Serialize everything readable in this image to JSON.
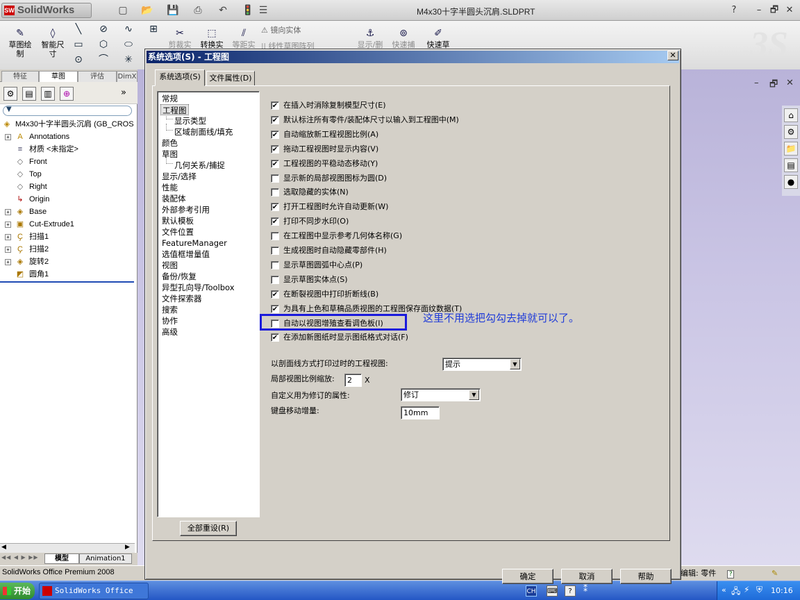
{
  "app": {
    "logo": "SolidWorks",
    "doc_title": "M4x30十字半圆头沉肩.SLDPRT",
    "window_controls": [
      "?",
      "–",
      "🗗",
      "✕"
    ]
  },
  "toolbar": {
    "tools": [
      {
        "label": "草图绘\n制",
        "icon": "sketch-icon"
      },
      {
        "label": "智能尺\n寸",
        "icon": "dimension-icon"
      },
      {
        "label": "剪裁实",
        "icon": "trim-icon"
      },
      {
        "label": "转换实",
        "icon": "convert-icon"
      },
      {
        "label": "等距实",
        "icon": "offset-icon"
      },
      {
        "label": "显示/删",
        "icon": "display-delete-icon"
      },
      {
        "label": "快速捕",
        "icon": "quick-snap-icon"
      },
      {
        "label": "快速草",
        "icon": "rapid-sketch-icon"
      }
    ],
    "mirror_label": "镜向实体",
    "pattern_label": "线性草图阵列"
  },
  "left_pane": {
    "tabs": [
      "特征",
      "草图",
      "评估",
      "DimX"
    ],
    "active_tab": "草图",
    "root_label": "M4x30十字半圆头沉肩 (GB_CROS",
    "tree": [
      {
        "label": "Annotations",
        "icon": "A",
        "expand": true
      },
      {
        "label": "材质 <未指定>",
        "icon": "≡",
        "expand": false
      },
      {
        "label": "Front",
        "icon": "◇",
        "expand": false
      },
      {
        "label": "Top",
        "icon": "◇",
        "expand": false
      },
      {
        "label": "Right",
        "icon": "◇",
        "expand": false
      },
      {
        "label": "Origin",
        "icon": "↳",
        "expand": false
      },
      {
        "label": "Base",
        "icon": "◈",
        "expand": true
      },
      {
        "label": "Cut-Extrude1",
        "icon": "▣",
        "expand": true
      },
      {
        "label": "扫描1",
        "icon": "Ҫ",
        "expand": true
      },
      {
        "label": "扫描2",
        "icon": "Ҫ",
        "expand": true
      },
      {
        "label": "旋转2",
        "icon": "◈",
        "expand": true
      },
      {
        "label": "圆角1",
        "icon": "◩",
        "expand": false
      }
    ],
    "bottom_tabs": [
      "模型",
      "Animation1"
    ]
  },
  "dialog": {
    "title": "系统选项(S) - 工程图",
    "close": "✕",
    "tabs": [
      "系统选项(S)",
      "文件属性(D)"
    ],
    "categories": [
      {
        "label": "常规",
        "indent": 0
      },
      {
        "label": "工程图",
        "indent": 0,
        "selected": true
      },
      {
        "label": "显示类型",
        "indent": 1
      },
      {
        "label": "区域剖面线/填充",
        "indent": 1
      },
      {
        "label": "颜色",
        "indent": 0
      },
      {
        "label": "草图",
        "indent": 0
      },
      {
        "label": "几何关系/捕捉",
        "indent": 1
      },
      {
        "label": "显示/选择",
        "indent": 0
      },
      {
        "label": "性能",
        "indent": 0
      },
      {
        "label": "装配体",
        "indent": 0
      },
      {
        "label": "外部参考引用",
        "indent": 0
      },
      {
        "label": "默认模板",
        "indent": 0
      },
      {
        "label": "文件位置",
        "indent": 0
      },
      {
        "label": "FeatureManager",
        "indent": 0
      },
      {
        "label": "选值框增量值",
        "indent": 0
      },
      {
        "label": "视图",
        "indent": 0
      },
      {
        "label": "备份/恢复",
        "indent": 0
      },
      {
        "label": "异型孔向导/Toolbox",
        "indent": 0
      },
      {
        "label": "文件探索器",
        "indent": 0
      },
      {
        "label": "搜索",
        "indent": 0
      },
      {
        "label": "协作",
        "indent": 0
      },
      {
        "label": "高级",
        "indent": 0
      }
    ],
    "reset_button": "全部重设(R)",
    "options": [
      {
        "label": "在插入时消除复制模型尺寸(E)",
        "checked": true
      },
      {
        "label": "默认标注所有零件/装配体尺寸以输入到工程图中(M)",
        "checked": true
      },
      {
        "label": "自动缩放新工程视图比例(A)",
        "checked": true
      },
      {
        "label": "拖动工程视图时显示内容(V)",
        "checked": true
      },
      {
        "label": "工程视图的平稳动态移动(Y)",
        "checked": true
      },
      {
        "label": "显示新的局部视图图标为圆(D)",
        "checked": false
      },
      {
        "label": "选取隐藏的实体(N)",
        "checked": false
      },
      {
        "label": "打开工程图时允许自动更新(W)",
        "checked": true
      },
      {
        "label": "打印不同步水印(O)",
        "checked": true
      },
      {
        "label": "在工程图中显示参考几何体名称(G)",
        "checked": false
      },
      {
        "label": "生成视图时自动隐藏零部件(H)",
        "checked": false
      },
      {
        "label": "显示草图圆弧中心点(P)",
        "checked": false
      },
      {
        "label": "显示草图实体点(S)",
        "checked": false
      },
      {
        "label": "在断裂视图中打印折断线(B)",
        "checked": true
      },
      {
        "label": "为具有上色和草稿品质视图的工程图保存面纹数据(T)",
        "checked": true
      },
      {
        "label": "自动以视图增殖查看调色板(I)",
        "checked": false
      },
      {
        "label": "在添加新图纸时显示图纸格式对话(F)",
        "checked": true
      }
    ],
    "annotation_note": "这里不用选把勾勾去掉就可以了。",
    "fields": {
      "print_crosshatch_label": "以剖面线方式打印过时的工程视图:",
      "print_crosshatch_value": "提示",
      "detail_scale_label": "局部视图比例缩放:",
      "detail_scale_value": "2",
      "detail_scale_unit": "X",
      "revision_label": "自定义用为修订的属性:",
      "revision_value": "修订",
      "keyboard_label": "键盘移动增量:",
      "keyboard_value": "10mm"
    },
    "buttons": {
      "ok": "确定",
      "cancel": "取消",
      "help": "帮助"
    }
  },
  "status_bar": {
    "text": "SolidWorks Office Premium 2008",
    "right_text": "编辑: 零件"
  },
  "taskbar": {
    "start": "开始",
    "task": "SolidWorks Office P...",
    "ime": "CH",
    "clock": "10:16"
  }
}
